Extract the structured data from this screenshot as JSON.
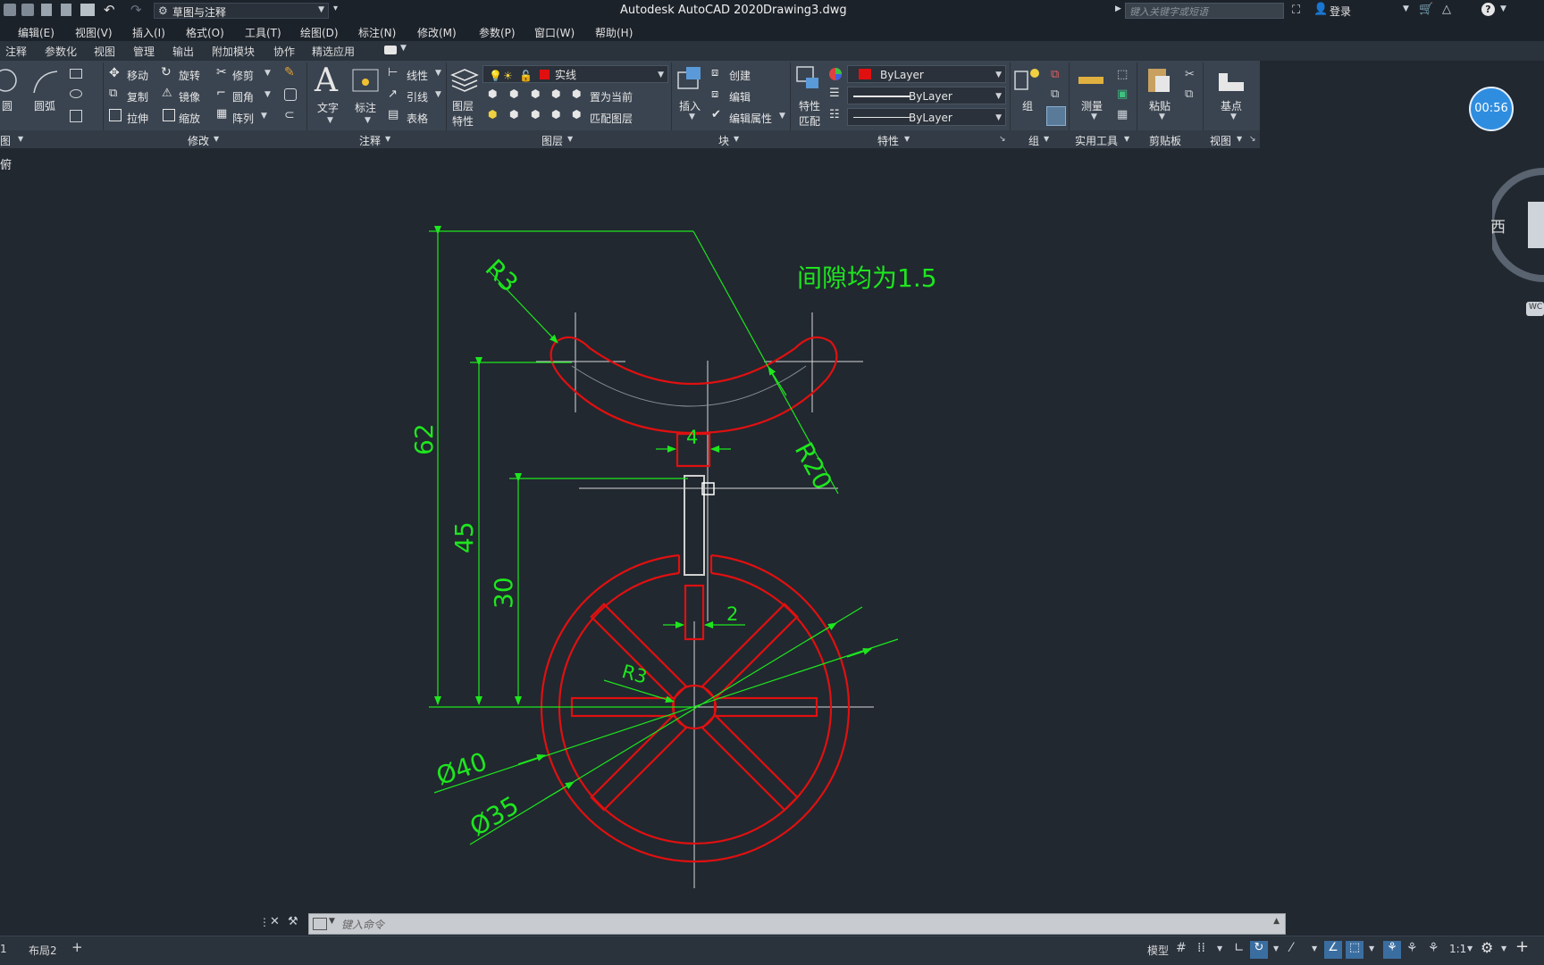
{
  "titlebar": {
    "workspace": "草图与注释",
    "app_title": "Autodesk AutoCAD 2020",
    "file_name": "Drawing3.dwg",
    "search_placeholder": "键入关键字或短语",
    "login": "登录"
  },
  "menubar": {
    "items": [
      "编辑(E)",
      "视图(V)",
      "插入(I)",
      "格式(O)",
      "工具(T)",
      "绘图(D)",
      "标注(N)",
      "修改(M)",
      "参数(P)",
      "窗口(W)",
      "帮助(H)"
    ]
  },
  "tabs": {
    "items": [
      "注释",
      "参数化",
      "视图",
      "管理",
      "输出",
      "附加模块",
      "协作",
      "精选应用"
    ]
  },
  "ribbon": {
    "draw": {
      "circle": "圆",
      "arc": "圆弧",
      "panel": "图"
    },
    "modify": {
      "move": "移动",
      "rotate": "旋转",
      "trim": "修剪",
      "copy": "复制",
      "mirror": "镜像",
      "fillet": "圆角",
      "stretch": "拉伸",
      "scale": "缩放",
      "array": "阵列",
      "panel": "修改"
    },
    "annotation": {
      "text": "文字",
      "dimension": "标注",
      "linear": "线性",
      "leader": "引线",
      "table": "表格",
      "panel": "注释"
    },
    "layers": {
      "props": "图层特性",
      "props_line1": "图层",
      "props_line2": "特性",
      "current_layer": "实线",
      "set_current": "置为当前",
      "match_layer": "匹配图层",
      "panel": "图层"
    },
    "block": {
      "insert": "插入",
      "create": "创建",
      "edit": "编辑",
      "edit_attr": "编辑属性",
      "panel": "块"
    },
    "properties": {
      "match_line1": "特性",
      "match_line2": "匹配",
      "color": "ByLayer",
      "linetype": "ByLayer",
      "lineweight": "ByLayer",
      "panel": "特性"
    },
    "groups": {
      "group": "组",
      "panel": "组"
    },
    "utilities": {
      "measure": "测量",
      "panel": "实用工具"
    },
    "clipboard": {
      "paste": "粘贴",
      "panel": "剪贴板"
    },
    "view": {
      "base": "基点",
      "panel": "视图"
    }
  },
  "timer": "00:56",
  "viewcube": {
    "west": "西",
    "wcs": "WC"
  },
  "viewport_label": "俯",
  "drawing": {
    "note": "间隙均为1.5",
    "dim_62": "62",
    "dim_45": "45",
    "dim_30": "30",
    "dim_R3_top": "R3",
    "dim_R20": "R20",
    "dim_4": "4",
    "dim_2": "2",
    "dim_R3_center": "R3",
    "dim_d40": "Ø40",
    "dim_d35": "Ø35"
  },
  "command": {
    "placeholder": "键入命令"
  },
  "statusbar": {
    "layout_tabs": [
      "1",
      "布局2"
    ],
    "add": "+",
    "model": "模型",
    "scale": "1:1"
  },
  "colors": {
    "dim_green": "#1ee61e",
    "red": "#e01010",
    "bg": "#212830"
  }
}
